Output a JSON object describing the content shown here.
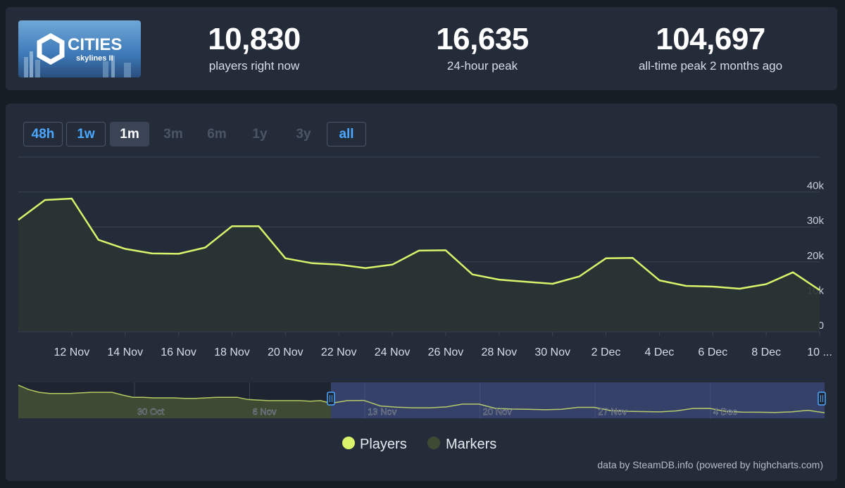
{
  "stats": [
    {
      "value": "10,830",
      "label": "players right now"
    },
    {
      "value": "16,635",
      "label": "24-hour peak"
    },
    {
      "value": "104,697",
      "label": "all-time peak 2 months ago"
    }
  ],
  "logo": {
    "title": "CITIES",
    "subtitle": "skylines II"
  },
  "range_buttons": [
    {
      "label": "48h",
      "state": "outlined"
    },
    {
      "label": "1w",
      "state": "outlined"
    },
    {
      "label": "1m",
      "state": "active"
    },
    {
      "label": "3m",
      "state": "disabled"
    },
    {
      "label": "6m",
      "state": "disabled"
    },
    {
      "label": "1y",
      "state": "disabled"
    },
    {
      "label": "3y",
      "state": "disabled"
    },
    {
      "label": "all",
      "state": "outlined"
    }
  ],
  "legend": {
    "players": "Players",
    "markers": "Markers"
  },
  "credit": "data by SteamDB.info (powered by highcharts.com)",
  "colors": {
    "players_line": "#d9f36a",
    "markers": "#3e4a33",
    "link": "#4ba7ff",
    "background": "#171d25",
    "panel": "#242c39"
  },
  "chart_data": {
    "type": "line",
    "x_unit": "day",
    "x_start": "2023-11-10",
    "x_end": "2023-12-10",
    "xticks": [
      "12 Nov",
      "14 Nov",
      "16 Nov",
      "18 Nov",
      "20 Nov",
      "22 Nov",
      "24 Nov",
      "26 Nov",
      "28 Nov",
      "30 Nov",
      "2 Dec",
      "4 Dec",
      "6 Dec",
      "8 Dec",
      "10 ..."
    ],
    "yticks": [
      "0",
      "10k",
      "20k",
      "30k",
      "40k"
    ],
    "ylim": [
      0,
      50000
    ],
    "grid": true,
    "legend_position": "bottom-center",
    "series": [
      {
        "name": "Players",
        "x": [
          "2023-11-10",
          "2023-11-11",
          "2023-11-12",
          "2023-11-13",
          "2023-11-14",
          "2023-11-15",
          "2023-11-16",
          "2023-11-17",
          "2023-11-18",
          "2023-11-19",
          "2023-11-20",
          "2023-11-21",
          "2023-11-22",
          "2023-11-23",
          "2023-11-24",
          "2023-11-25",
          "2023-11-26",
          "2023-11-27",
          "2023-11-28",
          "2023-11-29",
          "2023-11-30",
          "2023-12-01",
          "2023-12-02",
          "2023-12-03",
          "2023-12-04",
          "2023-12-05",
          "2023-12-06",
          "2023-12-07",
          "2023-12-08",
          "2023-12-09",
          "2023-12-10"
        ],
        "values": [
          32000,
          37700,
          38100,
          26300,
          23700,
          22400,
          22300,
          24100,
          30200,
          30200,
          21000,
          19600,
          19200,
          18200,
          19200,
          23200,
          23300,
          16400,
          14900,
          14300,
          13700,
          15800,
          21000,
          21100,
          14700,
          13100,
          12900,
          12300,
          13600,
          17000,
          11900
        ]
      }
    ],
    "navigator": {
      "xticks": [
        "30 Oct",
        "6 Nov",
        "13 Nov",
        "20 Nov",
        "27 Nov",
        "4 Dec"
      ],
      "selected_range": [
        "2023-11-10",
        "2023-12-10"
      ]
    }
  }
}
